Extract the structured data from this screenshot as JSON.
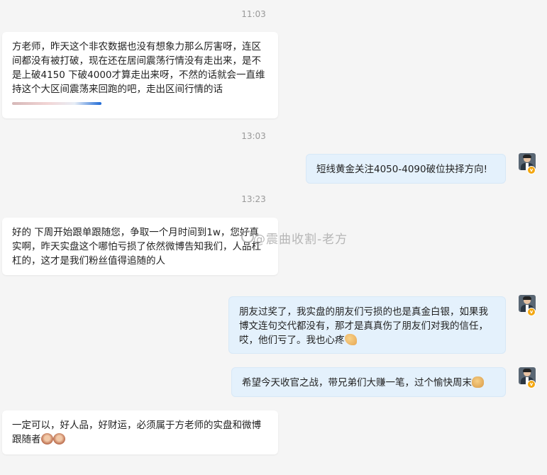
{
  "timestamps": [
    "11:03",
    "13:03",
    "13:23"
  ],
  "messages": [
    {
      "side": "left",
      "text": "方老师，昨天这个非农数据也没有想象力那么厉害呀，连区间都没有被打破，现在还在居间震荡行情没有走出来，是不是上破4150 下破4000才算走出来呀，不然的话就会一直维持这个大区间震荡来回跑的吧，走出区间行情的话"
    },
    {
      "side": "right",
      "text": "短线黄金关注4050-4090破位抉择方向!"
    },
    {
      "side": "left",
      "text": "好的 下周开始跟单跟随您，争取一个月时间到1w，您好真实啊，昨天实盘这个哪怕亏损了依然微博告知我们，人品杠杠的，这才是我们粉丝值得追随的人"
    },
    {
      "side": "right",
      "text": "朋友过奖了，我实盘的朋友们亏损的也是真金白银，如果我博文连句交代都没有，那才是真真伤了朋友们对我的信任，哎，他们亏了。我也心疼",
      "emoji": "palms-icon"
    },
    {
      "side": "right",
      "text": "希望今天收官之战，带兄弟们大赚一笔，过个愉快周末",
      "emoji": "fist-icon"
    },
    {
      "side": "left",
      "text": "一定可以，好人品，好财运，必须属于方老师的实盘和微博跟随者",
      "emoji": "monkey-icon"
    }
  ],
  "watermark": "@震曲收割-老方",
  "colors": {
    "background": "#f5f5f5",
    "left_bubble": "#ffffff",
    "right_bubble": "#e4f1fc",
    "timestamp": "#999999"
  }
}
